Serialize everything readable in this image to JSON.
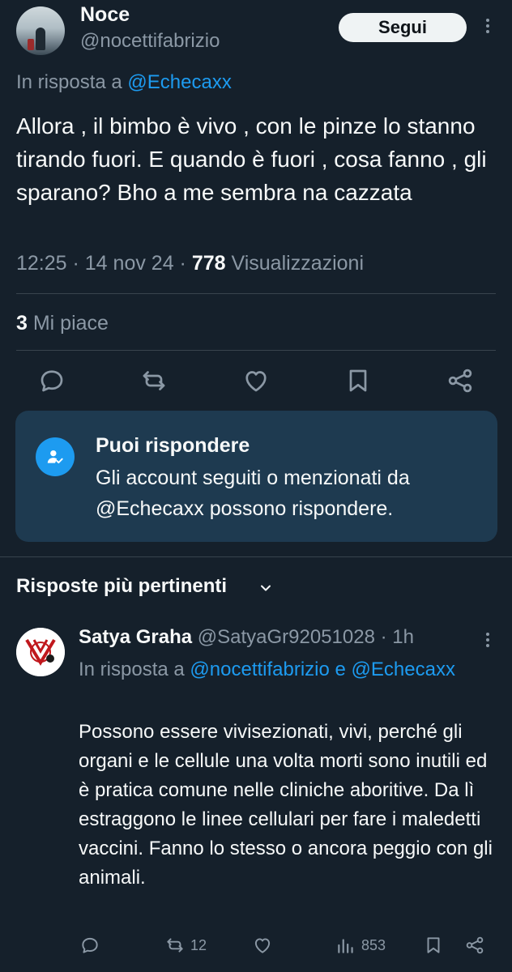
{
  "tweet": {
    "display_name": "Noce",
    "handle": "@nocettifabrizio",
    "follow_label": "Segui",
    "replying_prefix": "In risposta a ",
    "replying_to": "@Echecaxx",
    "text": "Allora , il bimbo è vivo , con le pinze lo stanno tirando fuori. E quando è fuori , cosa fanno , gli sparano? Bho a me sembra na cazzata",
    "time": "12:25",
    "date": "14 nov 24",
    "views_count": "778",
    "views_label": "Visualizzazioni",
    "likes_count": "3",
    "likes_label": "Mi piace"
  },
  "actions": {
    "icons": [
      "reply-icon",
      "retweet-icon",
      "like-icon",
      "bookmark-icon",
      "share-icon"
    ]
  },
  "reply_restriction": {
    "icon": "people-check-icon",
    "title": "Puoi rispondere",
    "body": "Gli account seguiti o menzionati da @Echecaxx possono rispondere."
  },
  "sort": {
    "label": "Risposte più pertinenti"
  },
  "reply": {
    "display_name": "Satya Graha",
    "handle": "@SatyaGr92051028",
    "separator": "·",
    "time_ago": "1h",
    "replying_prefix": "In risposta a ",
    "replying_to_1": "@nocettifabrizio",
    "replying_and": " e ",
    "replying_to_2": "@Echecaxx",
    "text": "Possono essere vivisezionati, vivi, perché gli organi e le cellule una volta morti sono inutili ed è pratica comune nelle cliniche aboritive. Da lì estraggono le linee cellulari per fare i maledetti vaccini. Fanno lo stesso o ancora peggio con gli animali.",
    "retweet_count": "12",
    "views_count": "853"
  },
  "colors": {
    "background": "#15202b",
    "accent": "#1d9bf0",
    "muted": "#8b98a5",
    "card": "#1e3a50"
  }
}
